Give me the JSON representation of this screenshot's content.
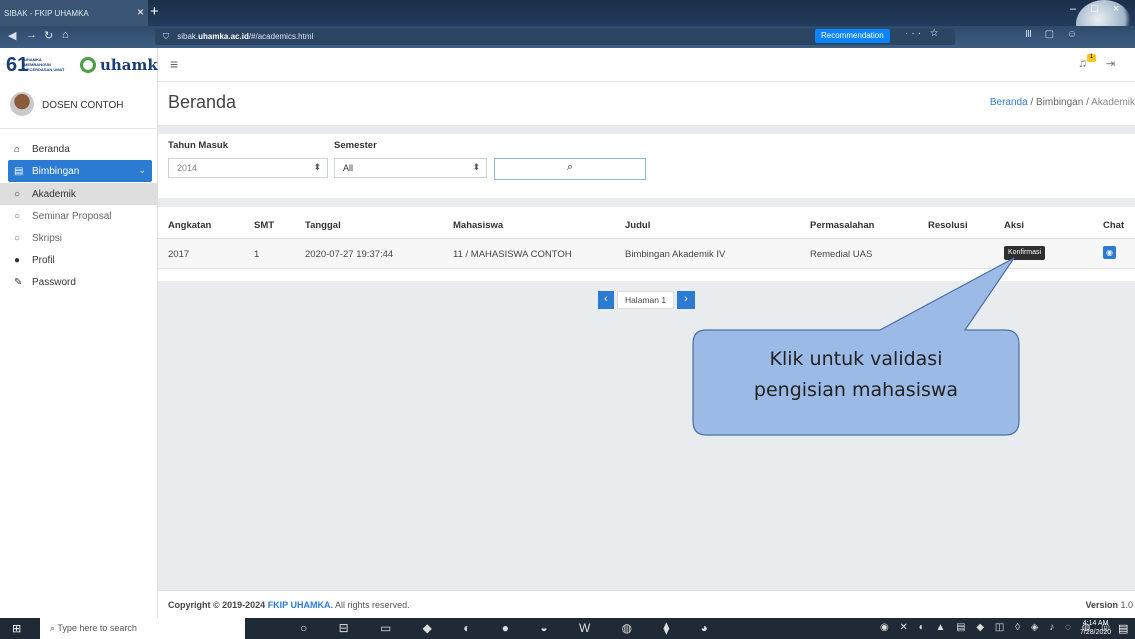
{
  "browser": {
    "tab_title": "SIBAK - FKIP UHAMKA",
    "tab_close": "×",
    "new_tab": "+",
    "url_prefix": "sibak.",
    "url_domain": "uhamka.ac.id",
    "url_path": "/#/academics.html",
    "recommendation_label": "Recommendation",
    "url_tools": "··· ☆",
    "browser_tools": "Ⅲ ▢ ☺",
    "window_controls": "– □ ×"
  },
  "logo": {
    "number": "61",
    "tagline_lines": [
      "UHAMKA",
      "MEMBANGUN",
      "KECERDASAN UMAT"
    ],
    "brand": "uhamka"
  },
  "topbar": {
    "notification_count": "1"
  },
  "sidebar": {
    "user_name": "DOSEN CONTOH",
    "items": [
      {
        "label": "Beranda",
        "icon": "home-icon"
      },
      {
        "label": "Bimbingan",
        "icon": "book-icon"
      },
      {
        "label": "Akademik",
        "icon": "circle-icon"
      },
      {
        "label": "Seminar Proposal",
        "icon": "circle-icon"
      },
      {
        "label": "Skripsi",
        "icon": "circle-icon"
      },
      {
        "label": "Profil",
        "icon": "user-icon"
      },
      {
        "label": "Password",
        "icon": "key-icon"
      }
    ]
  },
  "page": {
    "title": "Beranda",
    "breadcrumb": [
      "Beranda",
      "Bimbingan",
      "Akademik"
    ]
  },
  "filters": {
    "tahun_label": "Tahun Masuk",
    "tahun_value": "2014",
    "semester_label": "Semester",
    "semester_value": "All"
  },
  "table": {
    "headers": [
      "Angkatan",
      "SMT",
      "Tanggal",
      "Mahasiswa",
      "Judul",
      "Permasalahan",
      "Resolusi",
      "Aksi",
      "Chat"
    ],
    "rows": [
      {
        "angkatan": "2017",
        "smt": "1",
        "tanggal": "2020-07-27 19:37:44",
        "mahasiswa": "11 / MAHASISWA CONTOH",
        "judul": "Bimbingan Akademik IV",
        "permasalahan": "Remedial UAS",
        "resolusi": "",
        "aksi": "Konfirmasi"
      }
    ]
  },
  "pagination": {
    "label": "Halaman 1"
  },
  "footer": {
    "copyright_prefix": "Copyright © 2019-2024",
    "brand": "FKIP UHAMKA.",
    "rights": "All rights reserved.",
    "version_label": "Version",
    "version_value": "1.0"
  },
  "callout": {
    "line1": "Klik untuk validasi",
    "line2": "pengisian mahasiswa"
  },
  "taskbar": {
    "search_placeholder": "Type here to search",
    "time": "4:14 AM",
    "date": "7/28/2020"
  },
  "colors": {
    "primary": "#2b7bd3",
    "callout_fill": "#9bbbe6",
    "callout_stroke": "#4a6fa5"
  }
}
